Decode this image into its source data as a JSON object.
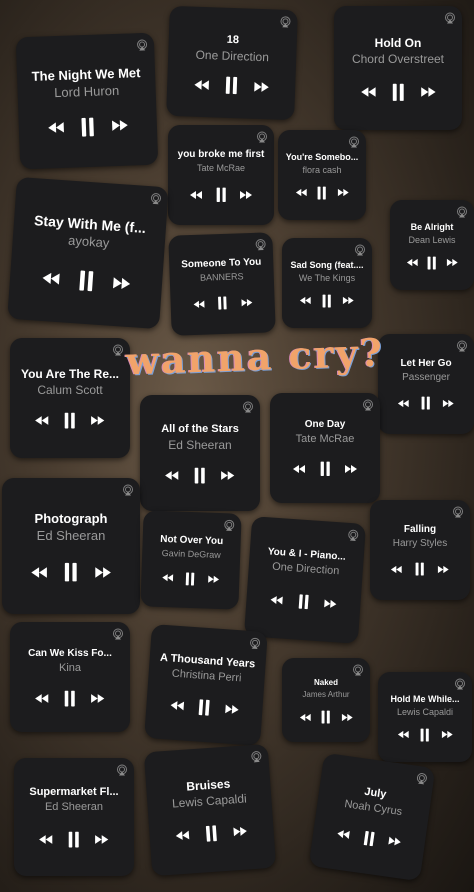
{
  "sticker": "wanna cry?",
  "cards": [
    {
      "title": "The Night We Met",
      "artist": "Lord Huron"
    },
    {
      "title": "18",
      "artist": "One Direction"
    },
    {
      "title": "Hold On",
      "artist": "Chord Overstreet"
    },
    {
      "title": "you broke me first",
      "artist": "Tate McRae"
    },
    {
      "title": "You're Somebo...",
      "artist": "flora cash"
    },
    {
      "title": "Stay With Me (f...",
      "artist": "ayokay"
    },
    {
      "title": "Someone To You",
      "artist": "BANNERS"
    },
    {
      "title": "Sad Song (feat....",
      "artist": "We The Kings"
    },
    {
      "title": "Be Alright",
      "artist": "Dean Lewis"
    },
    {
      "title": "You Are The Re...",
      "artist": "Calum Scott"
    },
    {
      "title": "Let Her Go",
      "artist": "Passenger"
    },
    {
      "title": "All of the Stars",
      "artist": "Ed Sheeran"
    },
    {
      "title": "One Day",
      "artist": "Tate McRae"
    },
    {
      "title": "Photograph",
      "artist": "Ed Sheeran"
    },
    {
      "title": "Not Over You",
      "artist": "Gavin DeGraw"
    },
    {
      "title": "You & I - Piano...",
      "artist": "One Direction"
    },
    {
      "title": "Falling",
      "artist": "Harry Styles"
    },
    {
      "title": "Can We Kiss Fo...",
      "artist": "Kina"
    },
    {
      "title": "A Thousand Years",
      "artist": "Christina Perri"
    },
    {
      "title": "Naked",
      "artist": "James Arthur"
    },
    {
      "title": "Hold Me While...",
      "artist": "Lewis Capaldi"
    },
    {
      "title": "Supermarket Fl...",
      "artist": "Ed Sheeran"
    },
    {
      "title": "Bruises",
      "artist": "Lewis Capaldi"
    },
    {
      "title": "July",
      "artist": "Noah Cyrus"
    }
  ]
}
